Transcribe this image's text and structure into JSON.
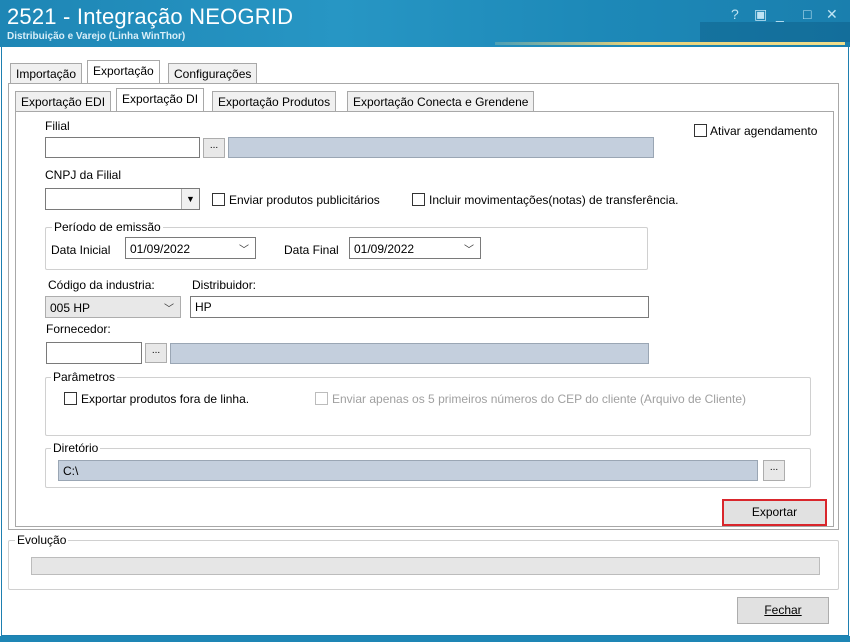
{
  "window": {
    "title": "2521 - Integração NEOGRID",
    "subtitle": "Distribuição e Varejo (Linha WinThor)",
    "controls": [
      "?",
      "▣",
      "_",
      "□",
      "✕"
    ]
  },
  "main_tabs": [
    {
      "label": "Importação",
      "active": false
    },
    {
      "label": "Exportação",
      "active": true
    },
    {
      "label": "Configurações",
      "active": false
    }
  ],
  "sub_tabs": [
    {
      "label": "Exportação EDI",
      "active": false
    },
    {
      "label": "Exportação DI",
      "active": true
    },
    {
      "label": "Exportação Produtos",
      "active": false
    },
    {
      "label": "Exportação Conecta e Grendene",
      "active": false
    }
  ],
  "form": {
    "filial_label": "Filial",
    "filial_value": "",
    "filial_button": "...",
    "filial_desc": "",
    "ativar_agendamento": "Ativar agendamento",
    "cnpj_label": "CNPJ da Filial",
    "cnpj_value": "",
    "enviar_publicitarios": "Enviar produtos publicitários",
    "incluir_movimentacoes": "Incluir movimentações(notas) de transferência.",
    "periodo_title": "Período de emissão",
    "data_inicial_label": "Data Inicial",
    "data_inicial_value": "01/09/2022",
    "data_final_label": "Data Final",
    "data_final_value": "01/09/2022",
    "codigo_industria_label": "Código da industria:",
    "codigo_industria_value": "005 HP",
    "distribuidor_label": "Distribuidor:",
    "distribuidor_value": "HP",
    "fornecedor_label": "Fornecedor:",
    "fornecedor_value": "",
    "fornecedor_button": "...",
    "fornecedor_desc": "",
    "parametros_title": "Parâmetros",
    "exportar_fora_linha": "Exportar produtos fora de linha.",
    "enviar_cep": "Enviar apenas os 5 primeiros números do CEP do cliente (Arquivo de Cliente)",
    "diretorio_title": "Diretório",
    "diretorio_value": "C:\\",
    "diretorio_button": "...",
    "exportar_button": "Exportar"
  },
  "evolucao": {
    "title": "Evolução",
    "progress": 0
  },
  "footer": {
    "fechar_button": "Fechar"
  }
}
